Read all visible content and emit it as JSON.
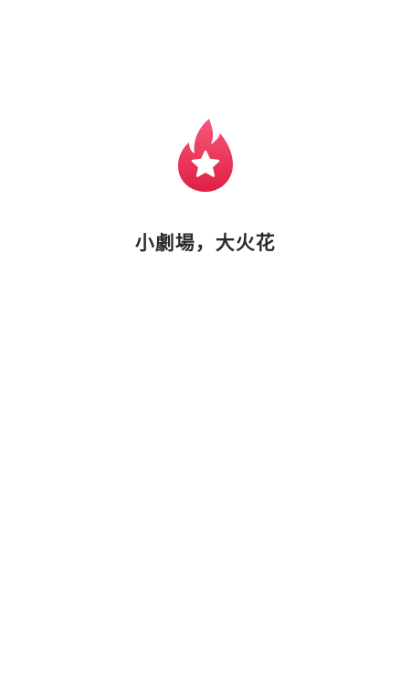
{
  "splash": {
    "tagline": "小劇場，大火花",
    "logo_icon": "flame-star-icon",
    "brand_color": "#e8294a"
  }
}
